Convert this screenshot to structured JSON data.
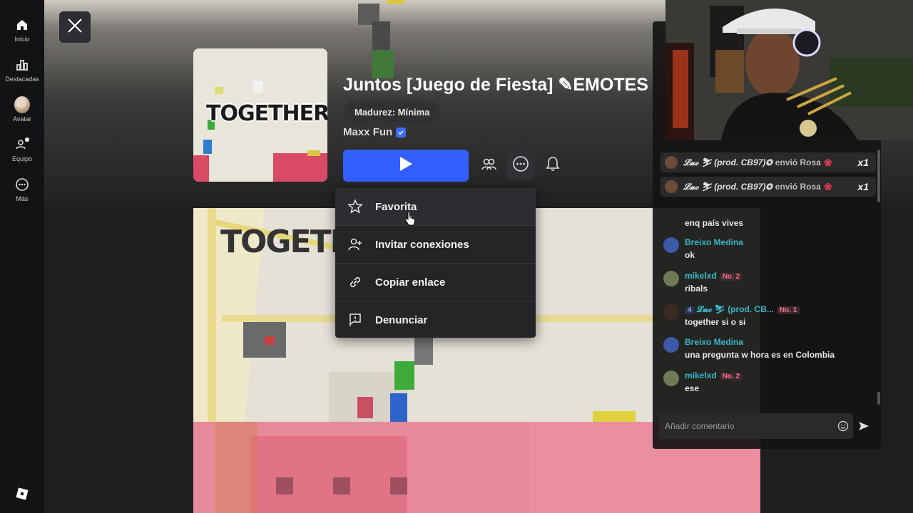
{
  "nav": {
    "items": [
      {
        "label": "Inicio",
        "icon": "home-icon"
      },
      {
        "label": "Destacadas",
        "icon": "charts-icon"
      },
      {
        "label": "Avatar",
        "icon": "avatar-icon"
      },
      {
        "label": "Equipo",
        "icon": "party-icon"
      },
      {
        "label": "Más",
        "icon": "more-icon"
      }
    ],
    "logo": "roblox-logo"
  },
  "game": {
    "title": "Juntos [Juego de Fiesta] ✎EMOTES",
    "thumbnail_text": "TOGETHER",
    "maturity": "Madurez: Mínima",
    "creator": "Maxx Fun",
    "preview_text": "TOGETHER"
  },
  "menu": {
    "items": [
      {
        "label": "Favorita",
        "icon": "star-icon"
      },
      {
        "label": "Invitar conexiones",
        "icon": "add-friend-icon"
      },
      {
        "label": "Copiar enlace",
        "icon": "link-icon"
      },
      {
        "label": "Denunciar",
        "icon": "report-flag-icon"
      }
    ]
  },
  "chat": {
    "gifts": [
      {
        "user": "𝓛𝓾𝓬 ⛷ (prod. CB97)❂",
        "text": "envió Rosa",
        "count": "x1"
      },
      {
        "user": "𝓛𝓾𝓬 ⛷ (prod. CB97)❂",
        "text": "envió Rosa",
        "count": "x1"
      }
    ],
    "messages": [
      {
        "name": "",
        "text": "enq país vives",
        "badge": "",
        "color": "#4a4a4a"
      },
      {
        "name": "Breixo Medina",
        "text": "ok",
        "badge": "",
        "color": "#3d5aa8"
      },
      {
        "name": "mikelxd",
        "text": "ribals",
        "badge": "No. 2",
        "color": "#6e7a55"
      },
      {
        "name": "𝓛𝓾𝓬 ⛷ (prod. CB...",
        "text": "together si o si",
        "badge": "No. 1",
        "level": "4",
        "color": "#3a2a22"
      },
      {
        "name": "Breixo Medina",
        "text": "una pregunta w hora es en Colombia",
        "badge": "",
        "color": "#3d5aa8"
      },
      {
        "name": "mikelxd",
        "text": "ese",
        "badge": "No. 2",
        "color": "#6e7a55"
      }
    ],
    "input_placeholder": "Añadir comentario"
  },
  "colors": {
    "play": "#335fff",
    "menu_bg": "#232527",
    "chat_name": "#39b8c8"
  }
}
